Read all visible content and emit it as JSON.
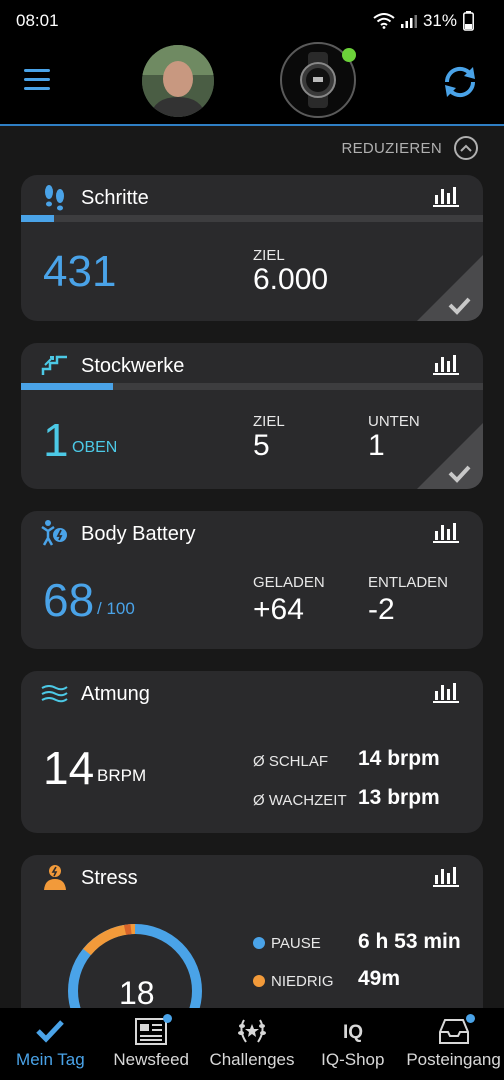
{
  "status": {
    "time": "08:01",
    "battery": "31%"
  },
  "header": {
    "menu_icon": "hamburger-icon",
    "sync_icon": "sync-icon"
  },
  "reduce": {
    "label": "REDUZIEREN"
  },
  "cards": {
    "steps": {
      "title": "Schritte",
      "value": "431",
      "goal_label": "ZIEL",
      "goal_value": "6.000",
      "progress": 0.072,
      "color": "#4aa3e8"
    },
    "floors": {
      "title": "Stockwerke",
      "value": "1",
      "unit": "OBEN",
      "goal_label": "ZIEL",
      "goal_value": "5",
      "down_label": "UNTEN",
      "down_value": "1",
      "progress": 0.2,
      "color": "#4cc9e6"
    },
    "battery": {
      "title": "Body Battery",
      "value": "68",
      "unit": "/ 100",
      "charged_label": "GELADEN",
      "charged_value": "+64",
      "drained_label": "ENTLADEN",
      "drained_value": "-2",
      "color": "#4aa3e8"
    },
    "respiration": {
      "title": "Atmung",
      "value": "14",
      "unit": "BRPM",
      "sleep_label": "Ø SCHLAF",
      "sleep_value": "14 brpm",
      "awake_label": "Ø WACHZEIT",
      "awake_value": "13 brpm"
    },
    "stress": {
      "title": "Stress",
      "value": "18",
      "rest_label": "PAUSE",
      "rest_value": "6 h 53 min",
      "low_label": "NIEDRIG",
      "low_value": "49m",
      "rest_color": "#4aa3e8",
      "low_color": "#f29a3a"
    }
  },
  "nav": [
    {
      "label": "Mein Tag",
      "icon": "checkmark-icon",
      "active": true
    },
    {
      "label": "Newsfeed",
      "icon": "newspaper-icon"
    },
    {
      "label": "Challenges",
      "icon": "laurel-icon"
    },
    {
      "label": "IQ-Shop",
      "icon": "iq-icon"
    },
    {
      "label": "Posteingang",
      "icon": "inbox-icon"
    }
  ]
}
